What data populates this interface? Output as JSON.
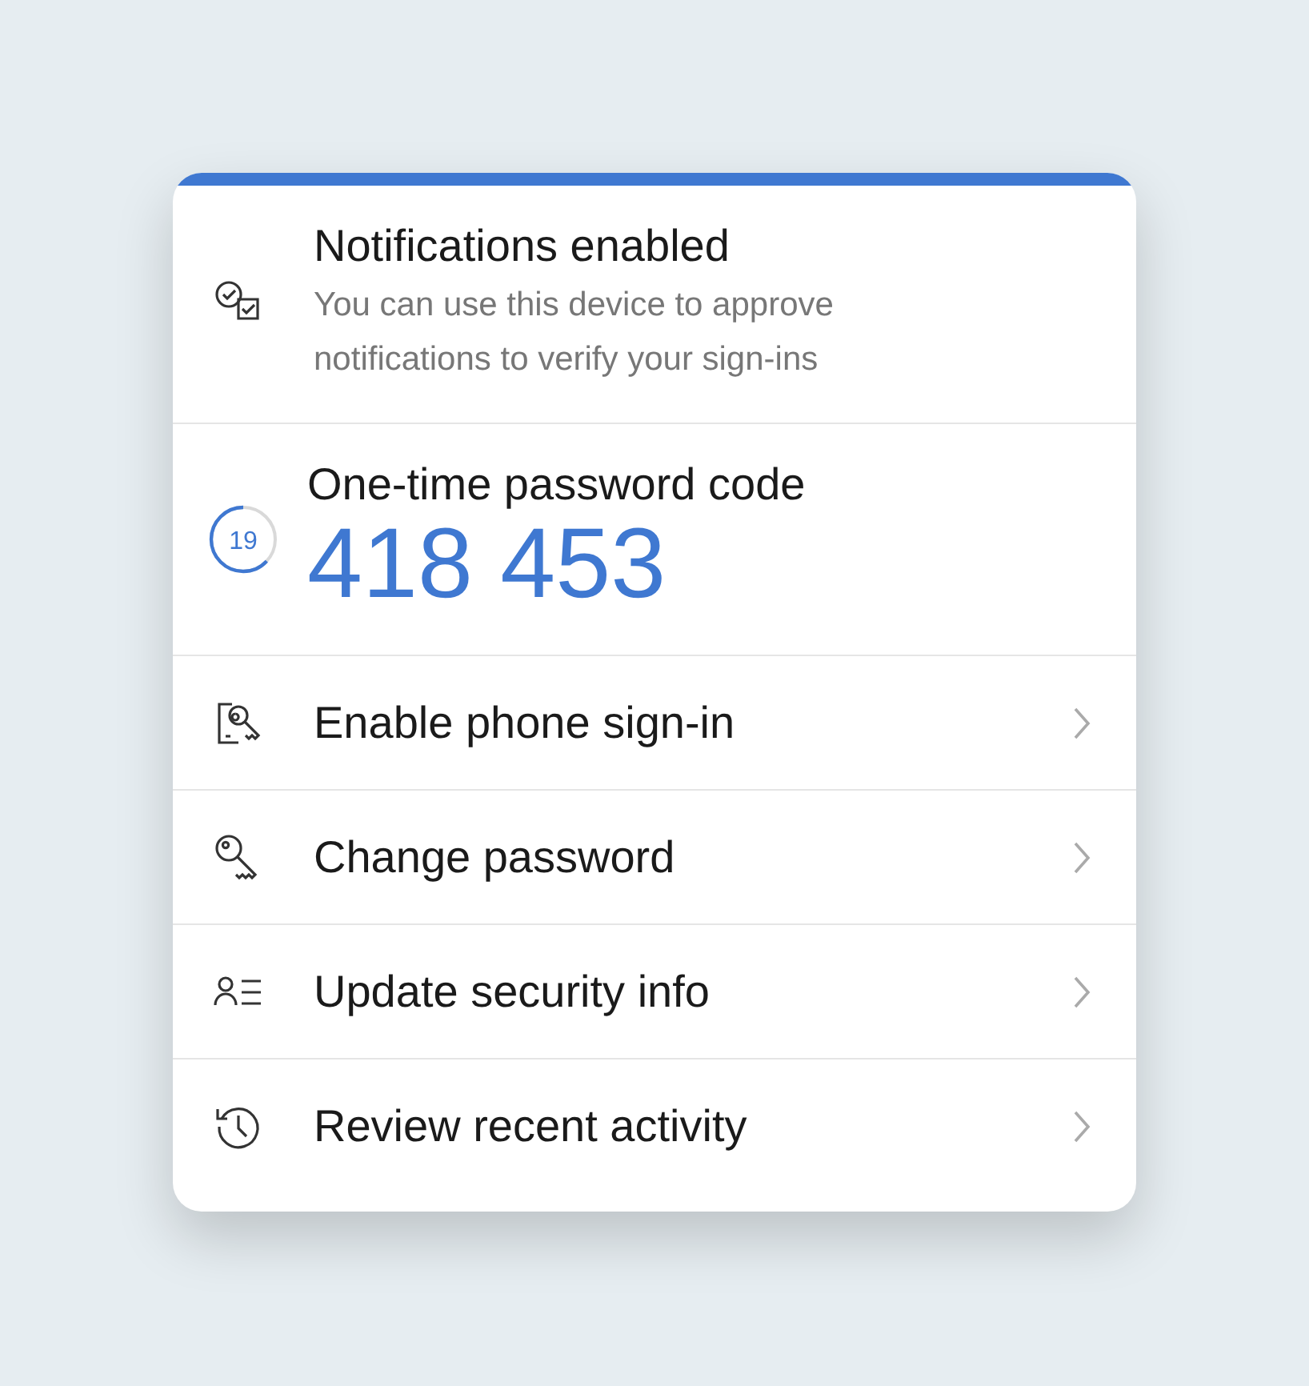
{
  "notifications": {
    "title": "Notifications enabled",
    "description": "You can use this device to approve notifications to verify your sign-ins"
  },
  "one_time_password": {
    "title": "One-time password code",
    "code": "418 453",
    "timer": {
      "seconds": "19",
      "level": 0.63
    }
  },
  "menu_items": [
    {
      "label": "Enable phone sign-in"
    },
    {
      "label": "Change password"
    },
    {
      "label": "Update security info"
    },
    {
      "label": "Review recent activity"
    }
  ]
}
